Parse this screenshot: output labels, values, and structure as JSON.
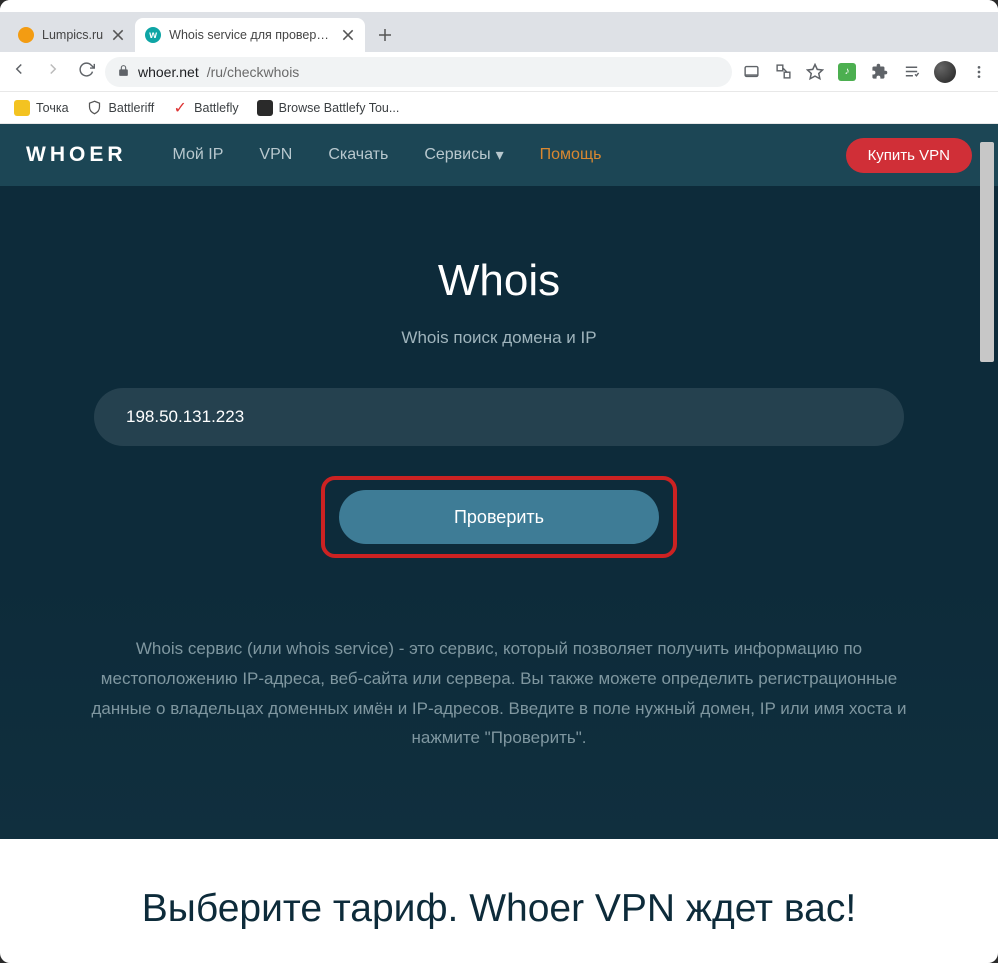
{
  "window": {
    "tabs": [
      {
        "title": "Lumpics.ru",
        "active": false
      },
      {
        "title": "Whois service для проверки дом...",
        "active": true
      }
    ]
  },
  "urlbar": {
    "host": "whoer.net",
    "path": "/ru/checkwhois"
  },
  "bookmarks": [
    {
      "label": "Точка"
    },
    {
      "label": "Battleriff"
    },
    {
      "label": "Battlefly"
    },
    {
      "label": "Browse Battlefy Tou..."
    }
  ],
  "header": {
    "logo": "WHOER",
    "nav": {
      "my_ip": "Мой IP",
      "vpn": "VPN",
      "download": "Скачать",
      "services": "Сервисы",
      "help": "Помощь"
    },
    "buy_vpn": "Купить VPN"
  },
  "hero": {
    "title": "Whois",
    "subtitle": "Whois поиск домена и IP",
    "input_value": "198.50.131.223",
    "check_label": "Проверить",
    "description": "Whois сервис (или whois service) - это сервис, который позволяет получить информацию по местоположению IP-адреса, веб-сайта или сервера. Вы также можете определить регистрационные данные о владельцах доменных имён и IP-адресов. Введите в поле нужный домен, IP или имя хоста и нажмите \"Проверить\"."
  },
  "bottom": {
    "heading": "Выберите тариф. Whoer VPN ждет вас!"
  }
}
